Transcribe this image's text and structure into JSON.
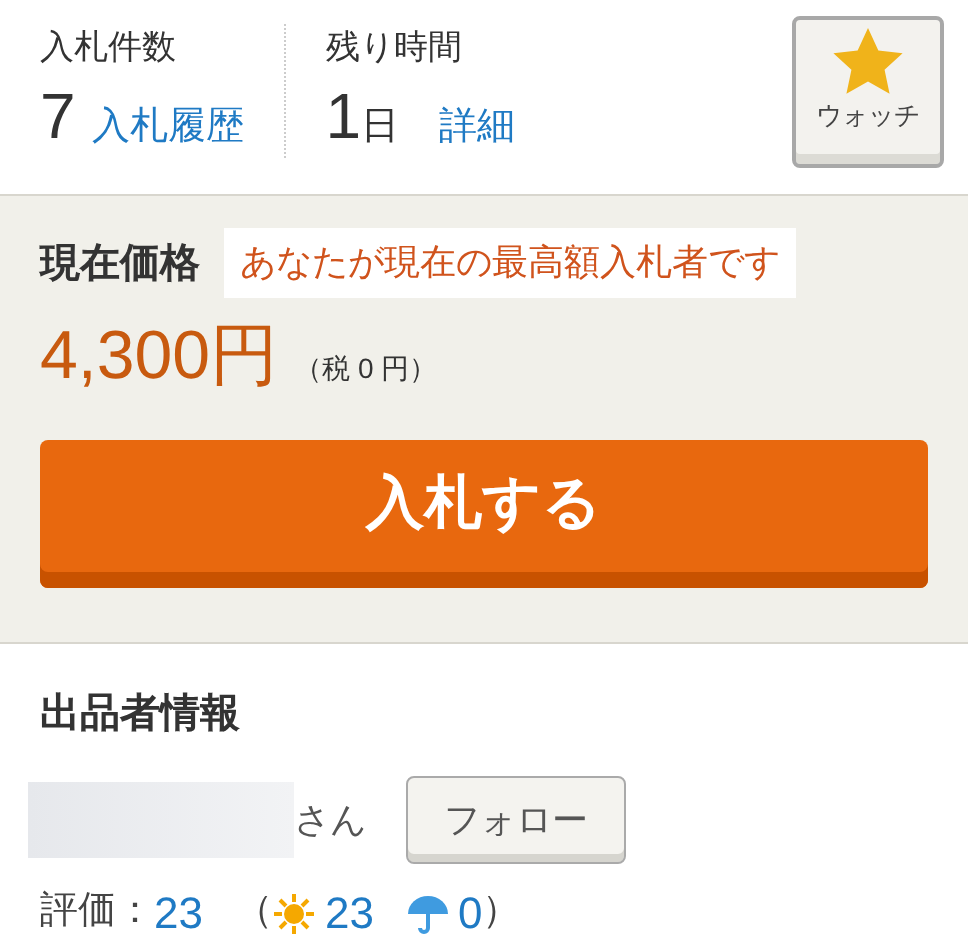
{
  "bids": {
    "label": "入札件数",
    "count": "7",
    "link": "入札履歴"
  },
  "time_left": {
    "label": "残り時間",
    "value": "1",
    "unit": "日",
    "link": "詳細"
  },
  "watch_button": {
    "label": "ウォッチ"
  },
  "price": {
    "label": "現在価格",
    "notice": "あなたが現在の最高額入札者です",
    "amount": "4,300円",
    "tax": "（税 0 円）"
  },
  "bid_button": {
    "label": "入札する"
  },
  "seller": {
    "heading": "出品者情報",
    "suffix": "さん",
    "follow_button": "フォロー",
    "rating_label": "評価：",
    "rating": "23",
    "open_paren": "（",
    "good": "23",
    "bad": "0",
    "close_paren": "）"
  }
}
